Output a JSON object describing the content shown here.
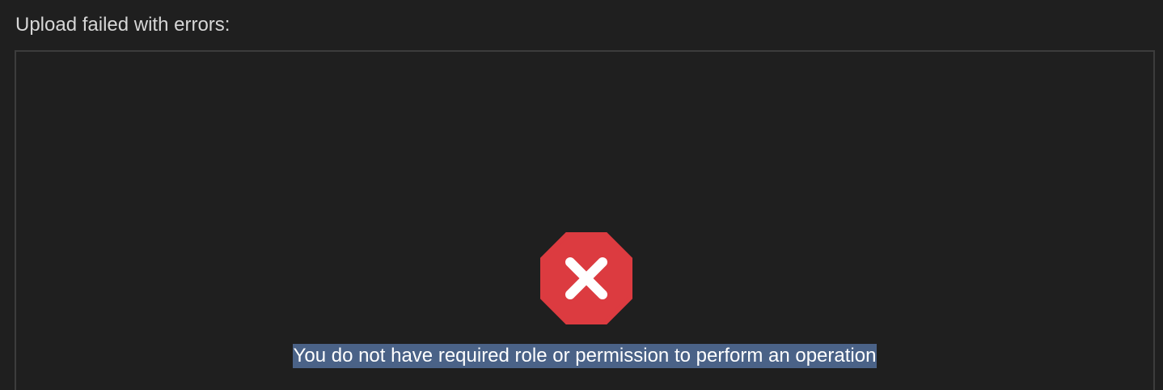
{
  "header": {
    "title": "Upload failed with errors:"
  },
  "error": {
    "icon": "error-octagon-x-icon",
    "message": "You do not have required role or permission to perform an operation",
    "selected": true
  },
  "colors": {
    "background": "#1f1f1f",
    "panel_border": "#3c3c3c",
    "header_text": "#d6d6d6",
    "error_icon": "#dc3b40",
    "selection_highlight": "#4a6287",
    "message_text": "#ffffff"
  }
}
